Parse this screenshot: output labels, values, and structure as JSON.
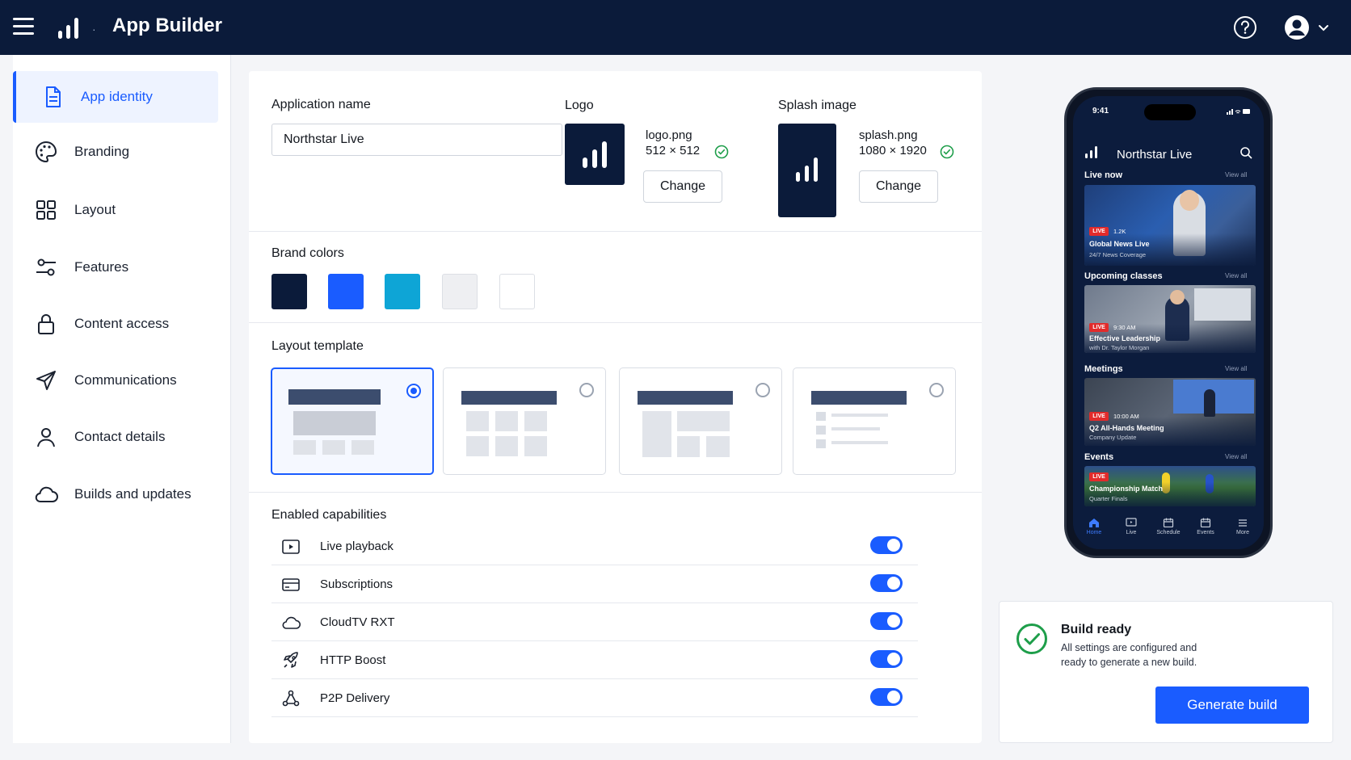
{
  "header": {
    "app_title": "App Builder",
    "menu_icon": "hamburger-icon",
    "logo_icon": "signal-bars-icon",
    "help_icon": "help-circle-icon",
    "account_icon": "user-avatar-icon"
  },
  "sidebar": {
    "items": [
      {
        "label": "App identity",
        "icon": "document-icon",
        "active": true
      },
      {
        "label": "Branding",
        "icon": "palette-icon"
      },
      {
        "label": "Layout",
        "icon": "grid-icon"
      },
      {
        "label": "Features",
        "icon": "sliders-icon"
      },
      {
        "label": "Content access",
        "icon": "lock-icon"
      },
      {
        "label": "Communications",
        "icon": "send-icon"
      },
      {
        "label": "Contact details",
        "icon": "person-icon"
      },
      {
        "label": "Builds and updates",
        "icon": "cloud-icon"
      }
    ]
  },
  "identity": {
    "app_name_label": "Application name",
    "app_name_value": "Northstar Live",
    "logo_label": "Logo",
    "logo_file": "logo.png",
    "logo_dims": "512 × 512",
    "splash_label": "Splash image",
    "splash_file": "splash.png",
    "splash_dims": "1080 × 1920",
    "change_label": "Change"
  },
  "brand_colors": {
    "label": "Brand colors",
    "swatches": [
      "#0b1b3a",
      "#1a5cff",
      "#0ea5d6",
      "#eeeff2",
      "#ffffff"
    ]
  },
  "layout_template": {
    "label": "Layout template",
    "selected_index": 0
  },
  "capabilities": {
    "label": "Enabled capabilities",
    "items": [
      {
        "label": "Live playback",
        "icon": "play-box-icon",
        "enabled": true
      },
      {
        "label": "Subscriptions",
        "icon": "card-icon",
        "enabled": true
      },
      {
        "label": "CloudTV RXT",
        "icon": "cloud-icon",
        "enabled": true
      },
      {
        "label": "HTTP Boost",
        "icon": "rocket-icon",
        "enabled": true
      },
      {
        "label": "P2P Delivery",
        "icon": "network-icon",
        "enabled": true
      }
    ]
  },
  "phone": {
    "time": "9:41",
    "title": "Northstar Live",
    "view_all": "View all",
    "live_badge": "LIVE",
    "sections": [
      {
        "heading": "Live now",
        "meta": "1.2K",
        "title": "Global News Live",
        "subtitle": "24/7 News Coverage"
      },
      {
        "heading": "Upcoming classes",
        "meta": "9:30 AM",
        "title": "Effective Leadership",
        "subtitle": "with Dr. Taylor Morgan"
      },
      {
        "heading": "Meetings",
        "meta": "10:00 AM",
        "title": "Q2 All-Hands Meeting",
        "subtitle": "Company Update"
      },
      {
        "heading": "Events",
        "meta": "",
        "title": "Championship Match",
        "subtitle": "Quarter Finals"
      }
    ],
    "nav": [
      "Home",
      "Live",
      "Schedule",
      "Events",
      "More"
    ]
  },
  "build": {
    "title": "Build ready",
    "description": "All settings are configured and ready to generate a new build.",
    "button": "Generate build"
  }
}
